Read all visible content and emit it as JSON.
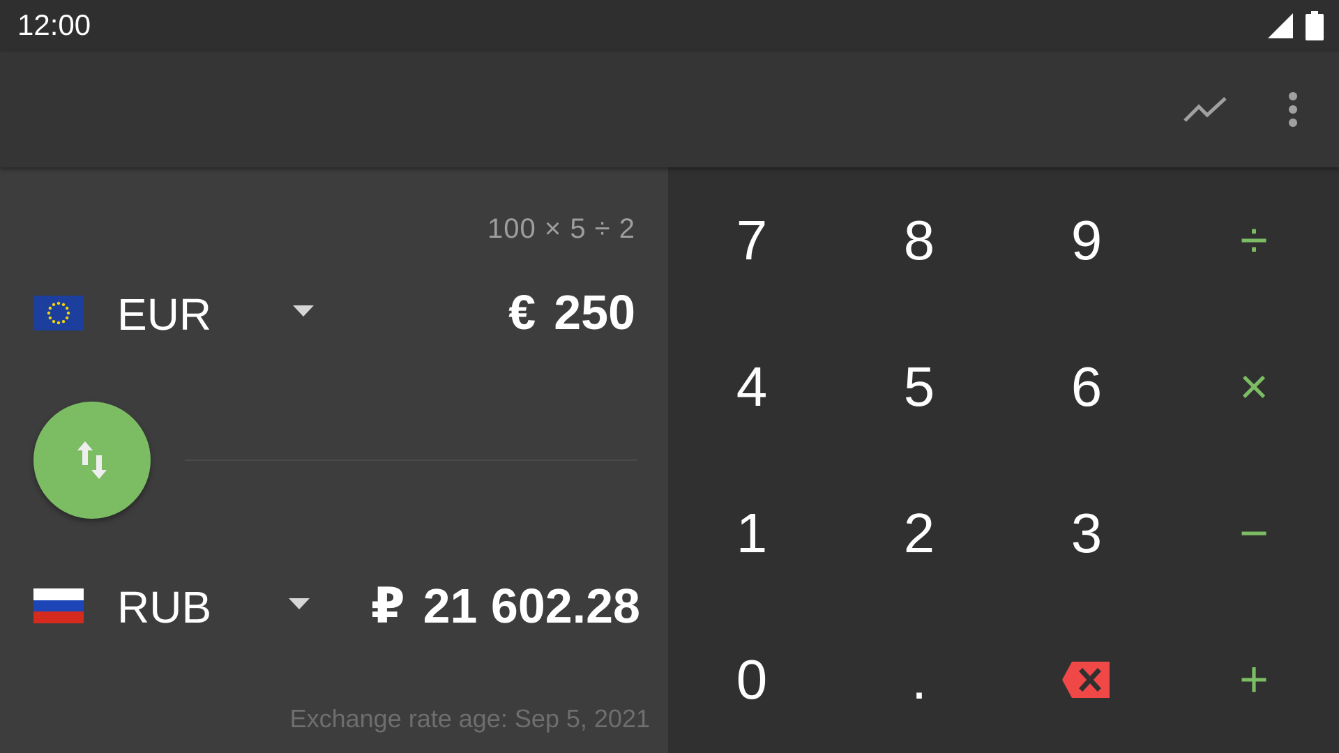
{
  "status_bar": {
    "time": "12:00",
    "icons": [
      "signal-icon",
      "battery-icon"
    ]
  },
  "app_bar": {
    "actions": [
      "trend-chart-icon",
      "more-vert-icon"
    ]
  },
  "converter": {
    "expression": "100 × 5 ÷ 2",
    "from": {
      "code": "EUR",
      "symbol": "€",
      "amount": "250",
      "flag": "eu-flag-icon"
    },
    "to": {
      "code": "RUB",
      "symbol": "₽",
      "amount": "21 602.28",
      "flag": "ru-flag-icon"
    },
    "rate_age": "Exchange rate age: Sep 5, 2021"
  },
  "keypad": {
    "keys": [
      {
        "label": "7",
        "type": "digit"
      },
      {
        "label": "8",
        "type": "digit"
      },
      {
        "label": "9",
        "type": "digit"
      },
      {
        "label": "÷",
        "type": "operator"
      },
      {
        "label": "4",
        "type": "digit"
      },
      {
        "label": "5",
        "type": "digit"
      },
      {
        "label": "6",
        "type": "digit"
      },
      {
        "label": "×",
        "type": "operator"
      },
      {
        "label": "1",
        "type": "digit"
      },
      {
        "label": "2",
        "type": "digit"
      },
      {
        "label": "3",
        "type": "digit"
      },
      {
        "label": "−",
        "type": "operator"
      },
      {
        "label": "0",
        "type": "digit"
      },
      {
        "label": ".",
        "type": "digit"
      },
      {
        "label": "",
        "type": "backspace"
      },
      {
        "label": "+",
        "type": "operator"
      }
    ]
  },
  "colors": {
    "accent": "#7cbd64",
    "backspace": "#f04747",
    "panel": "#3d3d3d",
    "keypad": "#303030",
    "app_bar": "#353535"
  }
}
